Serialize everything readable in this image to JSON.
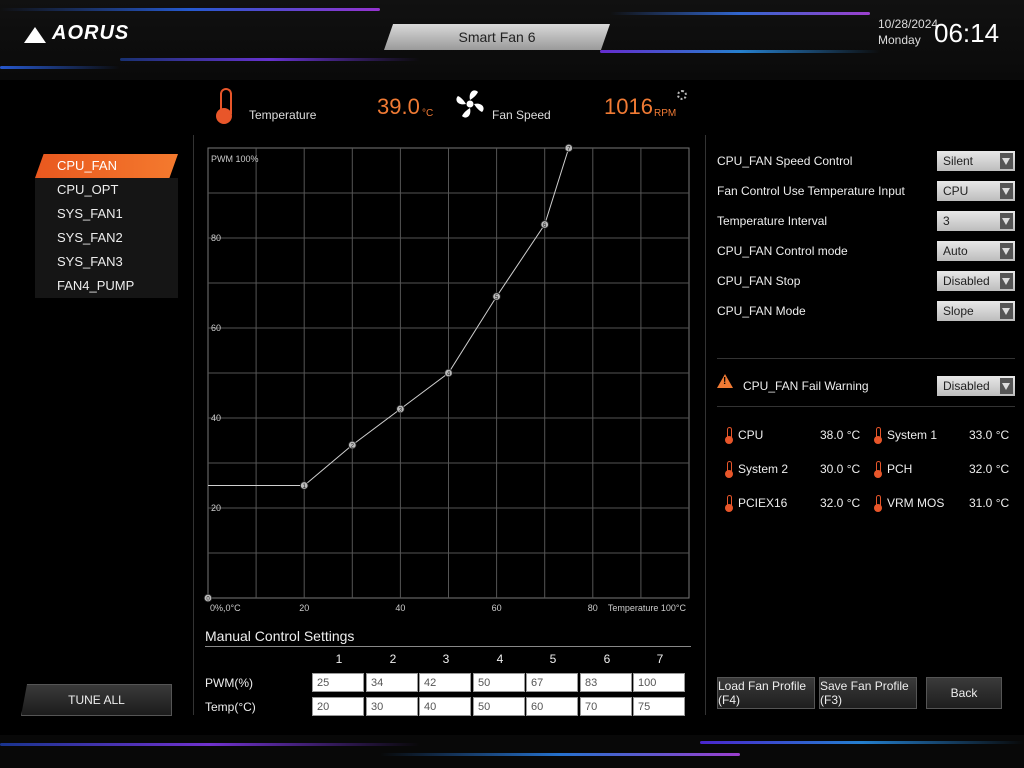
{
  "header": {
    "logo": "AORUS",
    "title": "Smart Fan 6",
    "date": "10/28/2024",
    "weekday": "Monday",
    "time": "06:14"
  },
  "status": {
    "temperature_label": "Temperature",
    "temperature_value": "39.0",
    "temperature_unit": "°C",
    "fan_speed_label": "Fan Speed",
    "fan_speed_value": "1016",
    "fan_speed_unit": "RPM"
  },
  "fan_list": {
    "items": [
      {
        "label": "CPU_FAN",
        "selected": true
      },
      {
        "label": "CPU_OPT",
        "selected": false
      },
      {
        "label": "SYS_FAN1",
        "selected": false
      },
      {
        "label": "SYS_FAN2",
        "selected": false
      },
      {
        "label": "SYS_FAN3",
        "selected": false
      },
      {
        "label": "FAN4_PUMP",
        "selected": false
      }
    ],
    "tune_all_label": "TUNE ALL"
  },
  "chart_data": {
    "type": "line",
    "ylabel": "PWM 100%",
    "xlabel": "Temperature 100°C",
    "origin_label": "0%,0°C",
    "xlim": [
      0,
      100
    ],
    "ylim": [
      0,
      100
    ],
    "x_ticks": [
      20,
      40,
      60,
      80
    ],
    "y_ticks": [
      20,
      40,
      60,
      80
    ],
    "points": [
      {
        "n": "0",
        "x": 0,
        "y": 0
      },
      {
        "n": "1",
        "x": 20,
        "y": 25
      },
      {
        "n": "2",
        "x": 30,
        "y": 34
      },
      {
        "n": "3",
        "x": 40,
        "y": 42
      },
      {
        "n": "4",
        "x": 50,
        "y": 50
      },
      {
        "n": "5",
        "x": 60,
        "y": 67
      },
      {
        "n": "6",
        "x": 70,
        "y": 83
      },
      {
        "n": "7",
        "x": 75,
        "y": 100
      }
    ],
    "flat_start": {
      "x": 0,
      "y": 25
    }
  },
  "manual": {
    "title": "Manual Control Settings",
    "columns": [
      "1",
      "2",
      "3",
      "4",
      "5",
      "6",
      "7"
    ],
    "pwm_label": "PWM(%)",
    "temp_label": "Temp(°C)",
    "pwm": [
      "25",
      "34",
      "42",
      "50",
      "67",
      "83",
      "100"
    ],
    "temp": [
      "20",
      "30",
      "40",
      "50",
      "60",
      "70",
      "75"
    ]
  },
  "settings": [
    {
      "label": "CPU_FAN Speed Control",
      "value": "Silent"
    },
    {
      "label": "Fan Control Use Temperature Input",
      "value": "CPU"
    },
    {
      "label": "Temperature Interval",
      "value": "3"
    },
    {
      "label": "CPU_FAN Control mode",
      "value": "Auto"
    },
    {
      "label": "CPU_FAN Stop",
      "value": "Disabled"
    },
    {
      "label": "CPU_FAN Mode",
      "value": "Slope"
    }
  ],
  "fail_warning": {
    "label": "CPU_FAN Fail Warning",
    "value": "Disabled"
  },
  "temps": [
    {
      "name": "CPU",
      "value": "38.0 °C"
    },
    {
      "name": "System 1",
      "value": "33.0 °C"
    },
    {
      "name": "System 2",
      "value": "30.0 °C"
    },
    {
      "name": "PCH",
      "value": "32.0 °C"
    },
    {
      "name": "PCIEX16",
      "value": "32.0 °C"
    },
    {
      "name": "VRM MOS",
      "value": "31.0 °C"
    }
  ],
  "buttons": {
    "load": "Load Fan Profile (F4)",
    "save": "Save Fan Profile (F3)",
    "back": "Back"
  },
  "colors": {
    "accent": "#f07a34",
    "selected": "#e9581f"
  }
}
